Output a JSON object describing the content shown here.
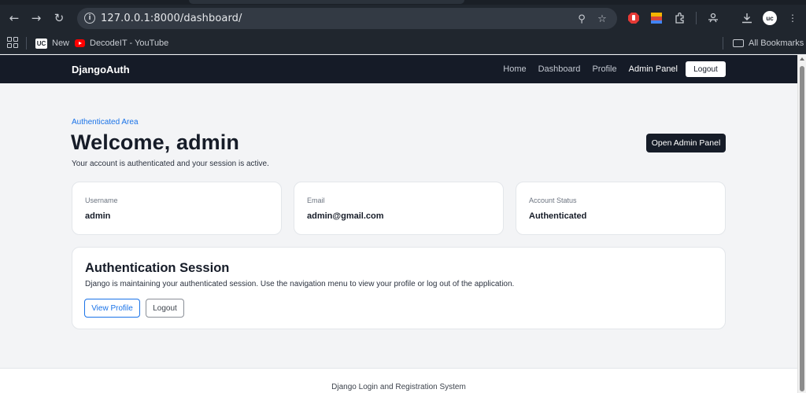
{
  "browser": {
    "url": "127.0.0.1:8000/dashboard/",
    "bookmarks": [
      {
        "label": "New",
        "icon": "uc-icon"
      },
      {
        "label": "DecodeIT - YouTube",
        "icon": "youtube-icon"
      }
    ],
    "all_bookmarks": "All Bookmarks",
    "avatar_initials": "uc"
  },
  "navbar": {
    "brand": "DjangoAuth",
    "links": [
      "Home",
      "Dashboard",
      "Profile",
      "Admin Panel"
    ],
    "logout": "Logout"
  },
  "header": {
    "eyebrow": "Authenticated Area",
    "title": "Welcome, admin",
    "subtitle": "Your account is authenticated and your session is active.",
    "admin_button": "Open Admin Panel"
  },
  "stats": [
    {
      "label": "Username",
      "value": "admin"
    },
    {
      "label": "Email",
      "value": "admin@gmail.com"
    },
    {
      "label": "Account Status",
      "value": "Authenticated"
    }
  ],
  "session": {
    "title": "Authentication Session",
    "text": "Django is maintaining your authenticated session. Use the navigation menu to view your profile or log out of the application.",
    "view_profile": "View Profile",
    "logout": "Logout"
  },
  "footer": {
    "text": "Django Login and Registration System"
  },
  "colors": {
    "navbar_bg": "#151b27",
    "accent": "#1a73e8",
    "page_bg": "#f3f4f6"
  }
}
